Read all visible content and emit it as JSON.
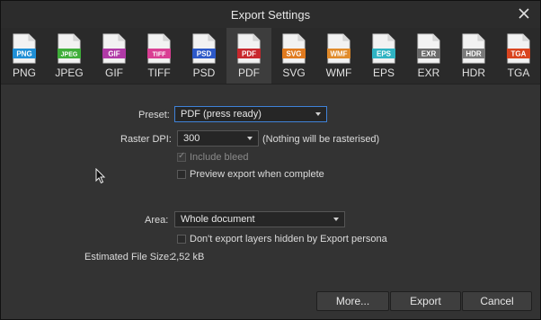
{
  "window": {
    "title": "Export Settings",
    "close_icon": "close-icon"
  },
  "formats": [
    {
      "tag": "PNG",
      "label": "PNG",
      "color": "#1f8fd6"
    },
    {
      "tag": "JPEG",
      "label": "JPEG",
      "color": "#3fae3a"
    },
    {
      "tag": "GIF",
      "label": "GIF",
      "color": "#b03aa6"
    },
    {
      "tag": "TIFF",
      "label": "TIFF",
      "color": "#d93f93"
    },
    {
      "tag": "PSD",
      "label": "PSD",
      "color": "#2d59c8"
    },
    {
      "tag": "PDF",
      "label": "PDF",
      "color": "#c8282d",
      "selected": true
    },
    {
      "tag": "SVG",
      "label": "SVG",
      "color": "#e07a1f"
    },
    {
      "tag": "WMF",
      "label": "WMF",
      "color": "#e08a2a"
    },
    {
      "tag": "EPS",
      "label": "EPS",
      "color": "#2fb3c2"
    },
    {
      "tag": "EXR",
      "label": "EXR",
      "color": "#6a6a6a"
    },
    {
      "tag": "HDR",
      "label": "HDR",
      "color": "#7a7a7a"
    },
    {
      "tag": "TGA",
      "label": "TGA",
      "color": "#d9441f"
    }
  ],
  "form": {
    "preset_label": "Preset:",
    "preset_value": "PDF (press ready)",
    "dpi_label": "Raster DPI:",
    "dpi_value": "300",
    "dpi_note": "(Nothing will be rasterised)",
    "include_bleed": {
      "label": "Include bleed",
      "checked": true,
      "disabled": true
    },
    "preview_export": {
      "label": "Preview export when complete",
      "checked": false
    },
    "area_label": "Area:",
    "area_value": "Whole document",
    "hidden_layers": {
      "label": "Don't export layers hidden by Export persona",
      "checked": false
    },
    "file_size_label": "Estimated File Size:",
    "file_size_value": "2,52 kB"
  },
  "buttons": {
    "more": "More...",
    "export": "Export",
    "cancel": "Cancel"
  },
  "colors": {
    "focus": "#3f82d8",
    "background": "#333333"
  }
}
